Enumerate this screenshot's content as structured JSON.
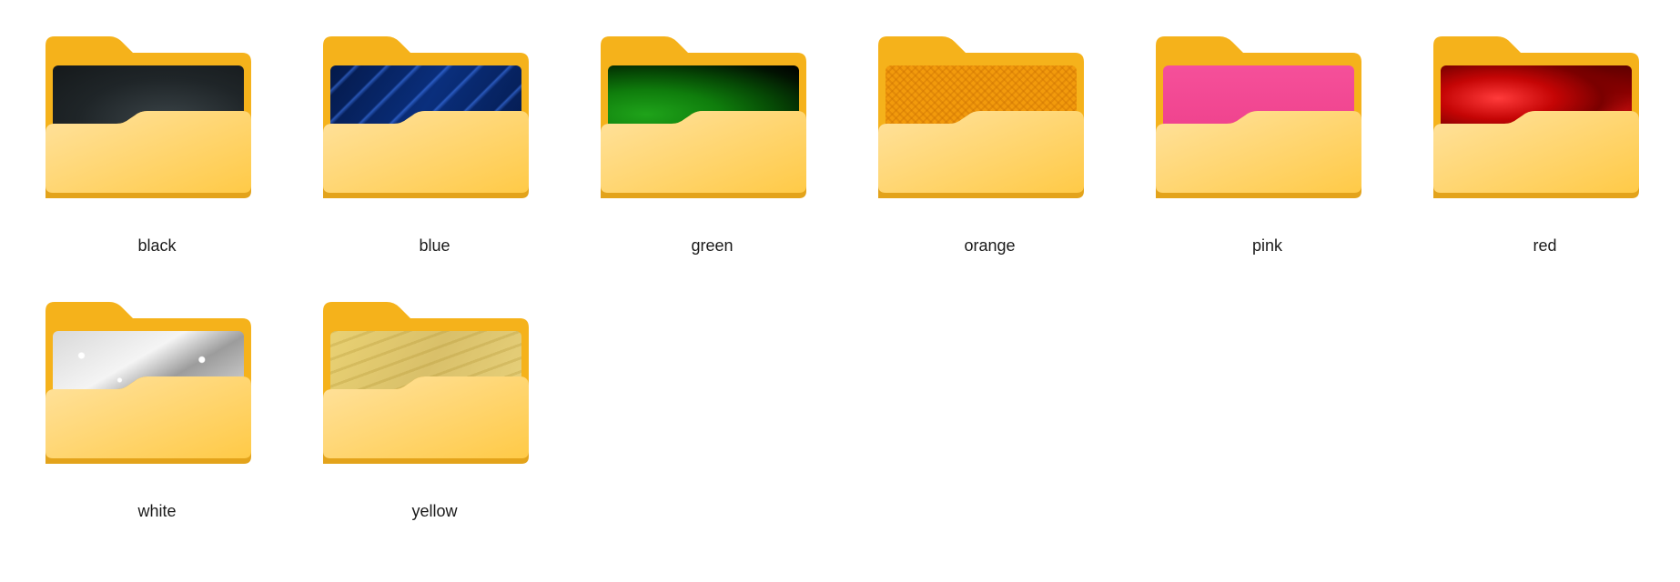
{
  "folders": [
    {
      "label": "black",
      "texture": "tex-black",
      "icon": "folder-icon"
    },
    {
      "label": "blue",
      "texture": "tex-blue",
      "icon": "folder-icon"
    },
    {
      "label": "green",
      "texture": "tex-green",
      "icon": "folder-icon"
    },
    {
      "label": "orange",
      "texture": "tex-orange",
      "icon": "folder-icon"
    },
    {
      "label": "pink",
      "texture": "tex-pink",
      "icon": "folder-icon"
    },
    {
      "label": "red",
      "texture": "tex-red",
      "icon": "folder-icon"
    },
    {
      "label": "white",
      "texture": "tex-white",
      "icon": "folder-icon"
    },
    {
      "label": "yellow",
      "texture": "tex-yellow",
      "icon": "folder-icon"
    }
  ],
  "colors": {
    "folder_back": "#f5b21b",
    "folder_front_top": "#ffe19a",
    "folder_front_bottom": "#ffcc4d",
    "folder_edge": "#e2a21a",
    "background": "#ffffff"
  }
}
